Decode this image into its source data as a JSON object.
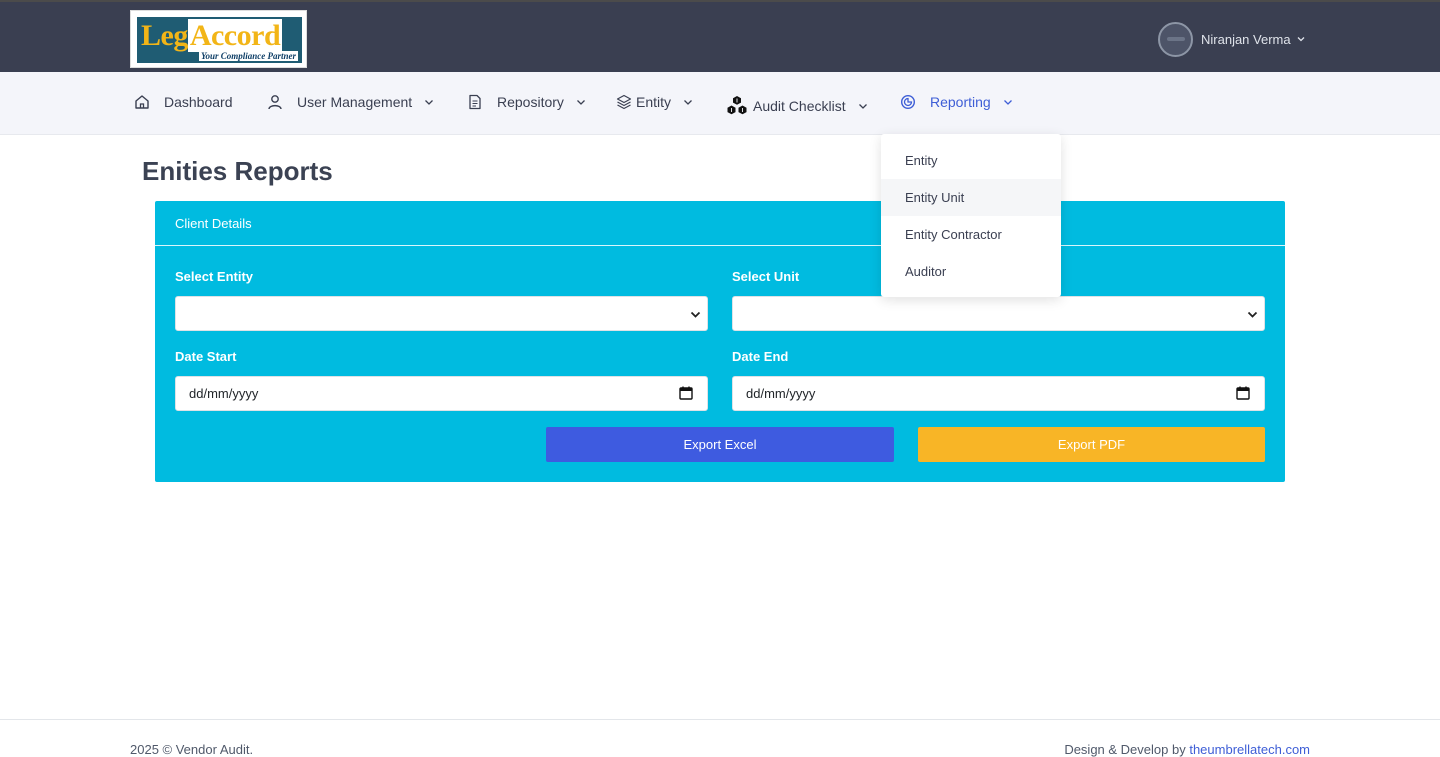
{
  "brand": {
    "logo_word_1": "Leg",
    "logo_word_2": "Accord",
    "logo_tagline": "Your Compliance Partner"
  },
  "user": {
    "name": "Niranjan Verma",
    "avatar_icon": "user-avatar",
    "chevron_icon": "chevron-down-icon"
  },
  "nav": {
    "items": [
      {
        "label": "Dashboard",
        "icon": "home-icon"
      },
      {
        "label": "User Management",
        "icon": "user-icon"
      },
      {
        "label": "Repository",
        "icon": "document-icon"
      },
      {
        "label": "Entity",
        "icon": "layers-icon"
      },
      {
        "label": "Audit Checklist",
        "icon": "cubes-icon"
      },
      {
        "label": "Reporting",
        "icon": "chart-icon"
      }
    ],
    "active": "Reporting"
  },
  "reporting_menu": {
    "items": [
      "Entity",
      "Entity Unit",
      "Entity Contractor",
      "Auditor"
    ],
    "hovered": "Entity Unit"
  },
  "page": {
    "title": "Enities Reports"
  },
  "card": {
    "header": "Client Details",
    "select_entity_label": "Select Entity",
    "select_entity_value": "",
    "select_unit_label": "Select Unit",
    "select_unit_value": "",
    "date_start_label": "Date Start",
    "date_start_placeholder": "dd/mm/yyyy",
    "date_end_label": "Date End",
    "date_end_placeholder": "dd/mm/yyyy",
    "export_excel_label": "Export Excel",
    "export_pdf_label": "Export PDF"
  },
  "footer": {
    "copyright": "2025 © Vendor Audit.",
    "credit_prefix": "Design & Develop by ",
    "credit_link": "theumbrellatech.com"
  },
  "colors": {
    "topbar": "#3a3f51",
    "navbar": "#f4f5fa",
    "card": "#00bbe0",
    "excel_button": "#3e5be0",
    "pdf_button": "#f8b526",
    "active_nav": "#3e5ed6"
  }
}
